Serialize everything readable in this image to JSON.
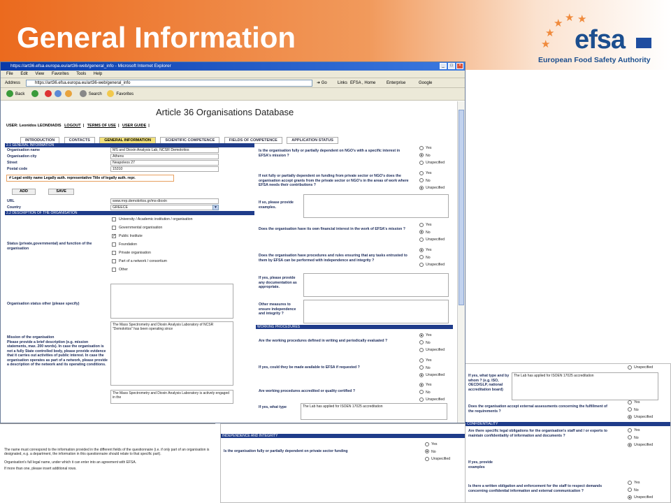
{
  "slide": {
    "title": "General Information",
    "logo_text": "efsa",
    "logo_subtitle": "European Food Safety Authority"
  },
  "browser": {
    "window_title": "https://art36.efsa.europa.eu/art36-web/general_info - Microsoft Internet Explorer",
    "menu": [
      "File",
      "Edit",
      "View",
      "Favorites",
      "Tools",
      "Help"
    ],
    "address_label": "Address",
    "address_url": "https://art36.efsa.europa.eu/art36-web/general_info",
    "go_label": "Go",
    "links_label": "Links",
    "links": [
      "EFSA , Home",
      "Enterprise",
      "Google"
    ],
    "toolbar": {
      "back": "Back",
      "search": "Search",
      "favorites": "Favorites"
    }
  },
  "app": {
    "db_title": "Article 36 Organisations Database",
    "user": "USER: Leonidos LEONDIADIS",
    "logout": "LOGOUT",
    "terms": "TERMS OF USE",
    "guide": "USER GUIDE",
    "tabs": [
      "INTRODUCTION",
      "CONTACTS",
      "GENERAL INFORMATION",
      "SCIENTIFIC COMPETENCE",
      "FIELDS OF COMPETENCE",
      "APPLICATION STATUS"
    ],
    "section1": "2.1 GENERAL INFORMATION",
    "fields": [
      {
        "label": "Organisation name",
        "value": "MS and Dioxin Analysis Lab, NCSR Demokritos"
      },
      {
        "label": "Organisation city",
        "value": "Athens"
      },
      {
        "label": "Street",
        "value": "Neapoleos 27"
      },
      {
        "label": "Postal code",
        "value": "15310"
      }
    ],
    "legal_line": "# Legal entity name  Legally auth. representative  Title of legally auth. repr.",
    "add_btn": "ADD",
    "save_btn": "SAVE",
    "url_label": "URL",
    "url_value": "www.mrp.demokritos.gr/ms-dioxin",
    "country_label": "Country",
    "country_value": "GREECE",
    "section2": "2.2 DESCRIPTION OF THE ORGANISATION",
    "status_label": "Status (private,governmental) and function of the organisation",
    "status_options": [
      "University / Academic institution / organisation",
      "Governmental organisation",
      "Public Institute",
      "Foundation",
      "Private organisation",
      "Part of a network / consortium",
      "Other"
    ],
    "status_other_label": "Organisation status other (please specify)",
    "mission_label": "Mission of the organisation",
    "mission_help": "Please provide a brief description (e.g. mission statements, max. 200 words). In case the organisation is not a fully State controlled body, please provide evidence that it carries out activities of public interest. In case the organisation operates as part of a network, please provide a description of the network and its operating conditions.",
    "mission_text": "The Mass Spectrometry and Dioxin Analysis Laboratory of NCSR \"Demokritos\" has been operating since",
    "mission_text2": "The Mass Spectrometry and Dioxin Analysis Laboratory is actively engaged in the",
    "questions": [
      "Is the organisation fully or partially dependent on NGO's with a specific interest in EFSA's mission ?",
      "If not fully or partially dependent on funding from private sector or NGO's does the organisation accept grants from the private sector or NGO's in the areas of work where EFSA needs their contributions ?",
      "If so, please provide examples.",
      "Does the organisation have its own financial interest in the work of EFSA's mission ?",
      "Does the organisation have procedures and rules ensuring that any tasks entrusted to them by EFSA can be performed with independence and integrity ?",
      "If yes, please provide any documentation as appropriate.",
      "Other measures to ensure independence and integrity ?"
    ],
    "working_section": "WORKING PROCEDURES",
    "working_q": [
      "Are the working procedures defined in writing and periodically evaluated ?",
      "If yes, could they be made available to EFSA if requested ?",
      "Are working procedures accredited or quality certified ?",
      "If yes, what type"
    ],
    "accreditation_text": "The Lab has applied for ISOEN 17025 accreditation",
    "radio_labels": [
      "Yes",
      "No",
      "Unspecified"
    ]
  },
  "back_sheet": {
    "section": "INDEPENDENCE AND INTEGRITY",
    "question": "Is the organisation fully or partially dependent on private sector funding",
    "footnotes": [
      "The name must correspond to the information provided in the different fields of the questionnaire (i.e. if only part of an organisation is designated, e.g. a department, the information in this questionnaire should relate to that specific part).",
      "Organisation's full legal name, under which it can enter into an agreement with EFSA.",
      "If more than one, please insert additional rows."
    ]
  },
  "side_sheet": {
    "unspecified": "Unspecified",
    "q1": "If yes, what type and by whom ? (e.g. ISO, OECD/GLP, national accreditation board)",
    "q1_text": "The Lab has applied for ISOEN 17025 accreditation",
    "q2": "Does the organisation accept external assessments concerning the fulfillment of the requirements ?",
    "section": "CONFIDENTIALITY",
    "q3": "Are there specific legal obligations for the organisation's staff and / or experts to maintain confidentiality of information and documents ?",
    "q4": "If yes, provide examples",
    "q5": "Is there a written obligation and enforcement for the staff to respect demands concerning confidential information and external communication ?"
  }
}
